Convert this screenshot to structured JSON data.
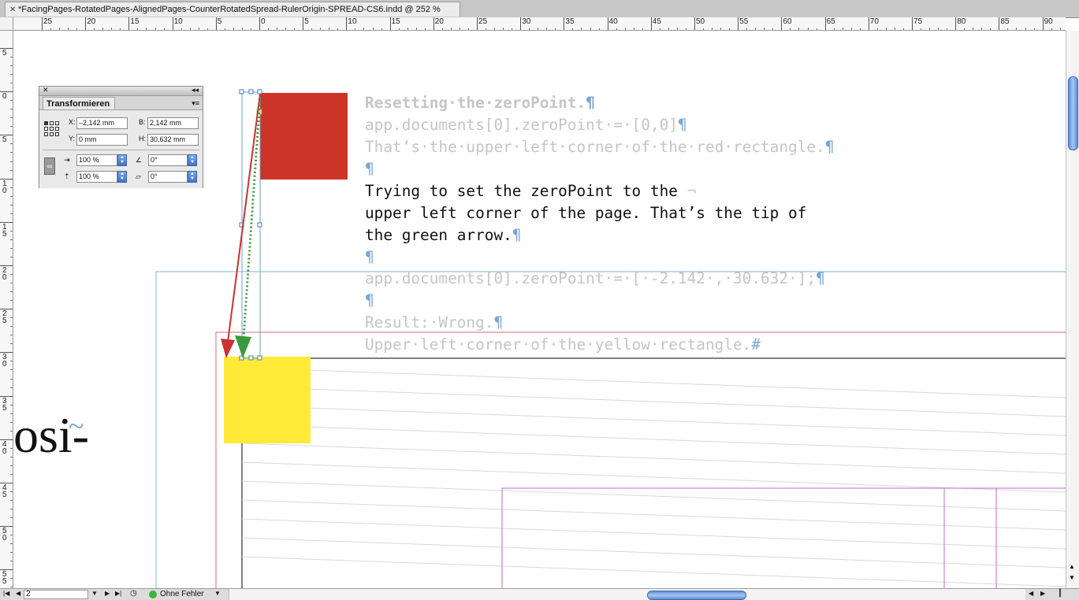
{
  "window": {
    "tab_title": "*FacingPages-RotatedPages-AlignedPages-CounterRotatedSpread-RulerOrigin-SPREAD-CS6.indd @ 252 %"
  },
  "rulers": {
    "horizontal_labels": [
      "25",
      "20",
      "15",
      "10",
      "5",
      "0",
      "5",
      "10",
      "15",
      "20",
      "25",
      "30",
      "35",
      "40",
      "45",
      "50",
      "55",
      "60",
      "65",
      "70",
      "75",
      "80",
      "85",
      "90"
    ],
    "vertical_labels": [
      "5",
      "0",
      "5",
      "10",
      "15",
      "20",
      "25",
      "30",
      "35",
      "40",
      "45",
      "50",
      "55"
    ]
  },
  "transform_panel": {
    "title": "Transformieren",
    "x_label": "X:",
    "x_value": "–2,142 mm",
    "y_label": "Y:",
    "y_value": "0 mm",
    "w_label": "B:",
    "w_value": "2,142 mm",
    "h_label": "H:",
    "h_value": "30,632 mm",
    "scale_x_value": "100 %",
    "scale_y_value": "100 %",
    "rotation_value": "0°",
    "shear_value": "0°"
  },
  "document_text": {
    "line1": "Resetting·the·zeroPoint.",
    "line2": "app.documents[0].zeroPoint·=·[0,0]",
    "line3": "That‘s·the·upper·left·corner·of·the·red·rectangle.",
    "line5": "Trying to set the zeroPoint to the ",
    "line5_mark": "¬",
    "line6": "upper left corner of the page. That’s the tip of ",
    "line7": "the green arrow.",
    "line9": "app.documents[0].zeroPoint·=·[·-2.142·,·30.632·];",
    "line11": "Result:·Wrong.",
    "line12": "Upper·left·corner·of·the·yellow·rectangle.",
    "pilcrow": "¶",
    "end_mark": "#",
    "side_word": "osi-",
    "side_mark": "~"
  },
  "statusbar": {
    "page_number": "2",
    "preflight_status": "Ohne Fehler"
  },
  "colors": {
    "red_rect": "#cd3428",
    "yellow_rect": "#ffea37",
    "green_arrow": "#3a9a3a",
    "red_arrow": "#cc3030",
    "frame_blue": "#6aa3d6",
    "page_margin": "#c8485a",
    "purple_frame": "#b04fc0",
    "faded_text": "#c5c5c5",
    "scroll_thumb": "#5e8ed6"
  }
}
